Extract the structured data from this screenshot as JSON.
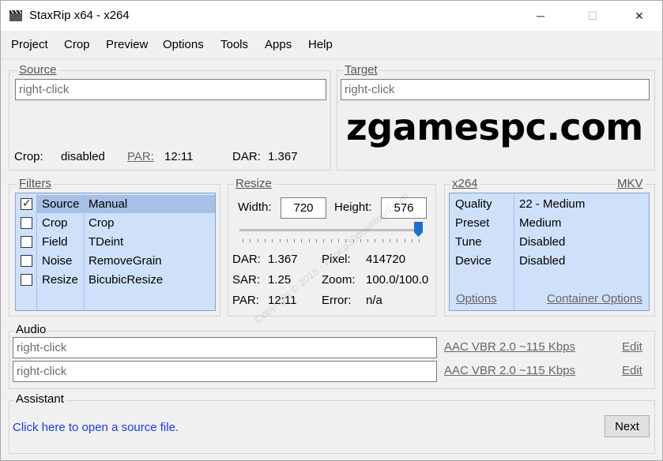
{
  "window": {
    "title": "StaxRip x64 - x264",
    "minimize_glyph": "─",
    "maximize_glyph": "☐",
    "close_glyph": "✕"
  },
  "menu": [
    "Project",
    "Crop",
    "Preview",
    "Options",
    "Tools",
    "Apps",
    "Help"
  ],
  "source": {
    "label": "Source",
    "path": "right-click",
    "crop_label": "Crop:",
    "crop_value": "disabled",
    "par_label": "PAR:",
    "par_value": "12:11",
    "dar_label": "DAR:",
    "dar_value": "1.367"
  },
  "target": {
    "label": "Target",
    "path": "right-click",
    "watermark": "zgamespc.com"
  },
  "filters": {
    "label": "Filters",
    "items": [
      {
        "name": "Source",
        "value": "Manual",
        "checked": true
      },
      {
        "name": "Crop",
        "value": "Crop",
        "checked": false
      },
      {
        "name": "Field",
        "value": "TDeint",
        "checked": false
      },
      {
        "name": "Noise",
        "value": "RemoveGrain",
        "checked": false
      },
      {
        "name": "Resize",
        "value": "BicubicResize",
        "checked": false
      }
    ]
  },
  "resize": {
    "label": "Resize",
    "width_label": "Width:",
    "width_value": "720",
    "height_label": "Height:",
    "height_value": "576",
    "slider_position": 1.0,
    "dar_label": "DAR:",
    "dar_value": "1.367",
    "pixel_label": "Pixel:",
    "pixel_value": "414720",
    "sar_label": "SAR:",
    "sar_value": "1.25",
    "zoom_label": "Zoom:",
    "zoom_value": "100.0/100.0",
    "par_label": "PAR:",
    "par_value": "12:11",
    "error_label": "Error:",
    "error_value": "n/a",
    "watermark_text": "Copyright © 2018 - www.p30download.com"
  },
  "encoder": {
    "label": "x264",
    "container": "MKV",
    "rows": [
      {
        "key": "Quality",
        "value": "22 - Medium"
      },
      {
        "key": "Preset",
        "value": "Medium"
      },
      {
        "key": "Tune",
        "value": "Disabled"
      },
      {
        "key": "Device",
        "value": "Disabled"
      }
    ],
    "options_link": "Options",
    "container_options_link": "Container Options"
  },
  "audio": {
    "label": "Audio",
    "tracks": [
      {
        "path": "right-click",
        "profile": "AAC VBR 2.0 ~115 Kbps",
        "edit": "Edit"
      },
      {
        "path": "right-click",
        "profile": "AAC VBR 2.0 ~115 Kbps",
        "edit": "Edit"
      }
    ]
  },
  "assistant": {
    "label": "Assistant",
    "message": "Click here to open a source file.",
    "next_label": "Next"
  },
  "colors": {
    "list_bg": "#cfe0fb",
    "selection": "#a7c0e6",
    "link": "#1a3fd6",
    "slider_thumb": "#1f6fd0"
  }
}
